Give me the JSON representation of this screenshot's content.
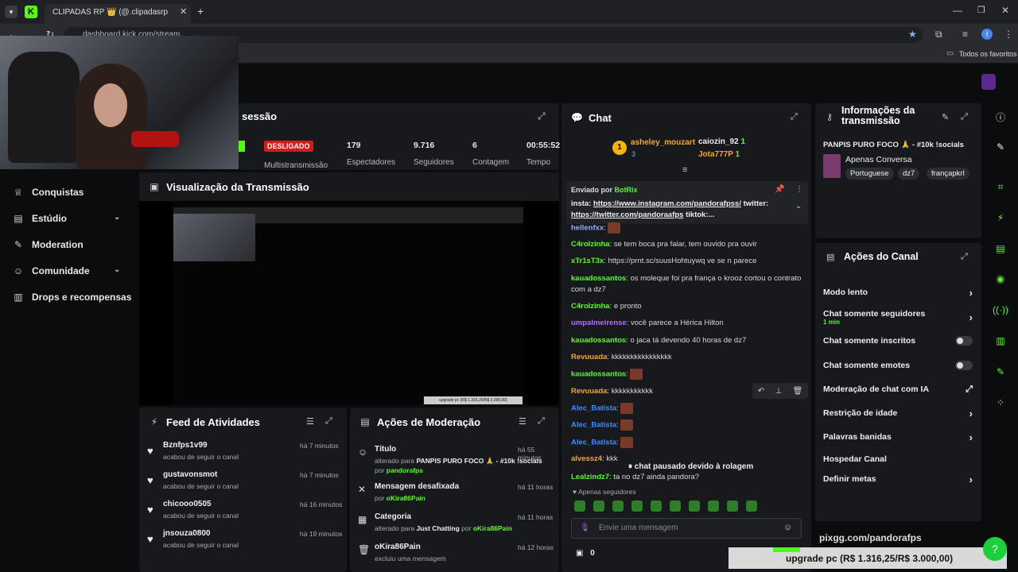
{
  "browser": {
    "tab_title": "CLIPADAS RP 👑 (@.clipadasrp",
    "url": "dashboard.kick.com/stream",
    "bookmarks_all": "Todos os favoritos",
    "profile_initial": "I"
  },
  "session": {
    "title": "sessão",
    "badge": "DESLIGADO",
    "multistream": "Multistransmissão",
    "stats": [
      {
        "value": "179",
        "label": "Espectadores"
      },
      {
        "value": "9.716",
        "label": "Seguidores"
      },
      {
        "value": "6",
        "label": "Contagem"
      },
      {
        "value": "00:55:52",
        "label": "Tempo"
      }
    ]
  },
  "sidebar": {
    "items": [
      {
        "label": "Conquistas",
        "icon": "trophy-icon"
      },
      {
        "label": "Estúdio",
        "icon": "studio-icon"
      },
      {
        "label": "Moderation",
        "icon": "wrench-icon"
      },
      {
        "label": "Comunidade",
        "icon": "people-icon"
      },
      {
        "label": "Drops e recompensas",
        "icon": "gift-icon"
      }
    ]
  },
  "preview": {
    "title": "Visualização da Transmissão",
    "overlay_text": "upgrade pc (R$ 1.316,25/R$ 3.000,00)"
  },
  "activity": {
    "title": "Feed de Atividades",
    "items": [
      {
        "user": "Bznfps1v99",
        "action": "acabou de seguir o canal",
        "time": "há 7 minutos"
      },
      {
        "user": "gustavonsmot",
        "action": "acabou de seguir o canal",
        "time": "há 7 minutos"
      },
      {
        "user": "chicooo0505",
        "action": "acabou de seguir o canal",
        "time": "há 16 minutos"
      },
      {
        "user": "jnsouza0800",
        "action": "acabou de seguir o canal",
        "time": "há 19 minutos"
      }
    ]
  },
  "modactions": {
    "title": "Ações de Moderação",
    "items": [
      {
        "title": "Título",
        "line1": "alterado para",
        "value": "PANPIS PURO FOCO 🙏 - #10k !socials",
        "by": "por",
        "user": "pandorafps",
        "time": "há 55 minutos"
      },
      {
        "title": "Mensagem desafixada",
        "line1": "",
        "value": "",
        "by": "por",
        "user": "oKira86Pain",
        "time": "há 11 horas"
      },
      {
        "title": "Categoria",
        "line1": "alterado para",
        "value": "Just Chatting",
        "by": "por",
        "user": "oKira86Pain",
        "time": "há 11 horas"
      },
      {
        "title": "oKira86Pain",
        "line1": "excluiu uma mensagem",
        "value": "",
        "by": "",
        "user": "",
        "time": "há 12 horas"
      }
    ]
  },
  "chat": {
    "title": "Chat",
    "top": [
      {
        "rank": "1",
        "user": "asheley_mouzart",
        "extra": "3"
      },
      {
        "user": "caiozin_92",
        "count": "1"
      },
      {
        "user": "Jota777P",
        "count": "1"
      }
    ],
    "pinned": {
      "sent_by": "Enviado por",
      "bot": "BotRix",
      "text_prefix": "insta:",
      "link1": "https://www.instagram.com/pandorafpss/",
      "mid": "twitter:",
      "link2": "https://twitter.com/pandoraafps",
      "suffix": "tiktok:..."
    },
    "messages": [
      {
        "user": "hellenfxx",
        "color": "#8fb2ff",
        "text": ""
      },
      {
        "user": "C4rolzinha",
        "color": "#53fc18",
        "text": "se tem boca pra falar, tem ouvido pra ouvir"
      },
      {
        "user": "xTr1sT3x",
        "color": "#53fc18",
        "text": "https://prnt.sc/suusHohtuywq ve se n parece"
      },
      {
        "user": "kauadossantos",
        "color": "#53fc18",
        "text": "os moleque foi pra frança o krooz cortou o contrato com a dz7"
      },
      {
        "user": "C4rolzinha",
        "color": "#53fc18",
        "text": "e pronto"
      },
      {
        "user": "umpalmeirense",
        "color": "#b86bff",
        "text": "você parece a Hérica Hilton"
      },
      {
        "user": "kauadossantos",
        "color": "#53fc18",
        "text": "o jaca tá devendo 40 horas de dz7"
      },
      {
        "user": "Revuuada",
        "color": "#f5a623",
        "text": "kkkkkkkkkkkkkkkk"
      },
      {
        "user": "kauadossantos",
        "color": "#53fc18",
        "text": ""
      },
      {
        "user": "Revuuada",
        "color": "#f5a623",
        "text": "kkkkkkkkkkk"
      },
      {
        "user": "Alec_Batista",
        "color": "#3d8bff",
        "text": ""
      },
      {
        "user": "Alec_Batista",
        "color": "#3d8bff",
        "text": ""
      },
      {
        "user": "Alec_Batista",
        "color": "#3d8bff",
        "text": ""
      },
      {
        "user": "alvessz4",
        "color": "#f5a623",
        "text": "kkk"
      },
      {
        "user": "Lealzindz7",
        "color": "#53fc18",
        "text": "ta no dz7 ainda pandora?"
      }
    ],
    "paused": "chat pausado devido à rolagem",
    "followers_only": "Apenas seguidores",
    "input_placeholder": "Envie uma mensagem",
    "points": "0"
  },
  "info": {
    "title": "Informações da transmissão",
    "stream_title": "PANPIS PURO FOCO 🙏 - #10k !socials",
    "category": "Apenas Conversa",
    "tags": [
      "Portuguese",
      "dz7",
      "françapkrl"
    ]
  },
  "channel_actions": {
    "title": "Ações do Canal",
    "items": [
      {
        "label": "Modo lento",
        "sub": "",
        "control": "chevron"
      },
      {
        "label": "Chat somente seguidores",
        "sub": "1 min",
        "control": "chevron"
      },
      {
        "label": "Chat somente inscritos",
        "sub": "",
        "control": "toggle"
      },
      {
        "label": "Chat somente emotes",
        "sub": "",
        "control": "toggle"
      },
      {
        "label": "Moderação de chat com IA",
        "sub": "",
        "control": "external"
      },
      {
        "label": "Restrição de idade",
        "sub": "",
        "control": "chevron"
      },
      {
        "label": "Palavras banidas",
        "sub": "",
        "control": "chevron"
      },
      {
        "label": "Hospedar Canal",
        "sub": "",
        "control": "none"
      },
      {
        "label": "Definir metas",
        "sub": "",
        "control": "chevron"
      }
    ]
  },
  "overlay": {
    "pixgg": "pixgg.com/pandorafps",
    "goal": "upgrade pc (R$ 1.316,25/R$ 3.000,00)"
  }
}
